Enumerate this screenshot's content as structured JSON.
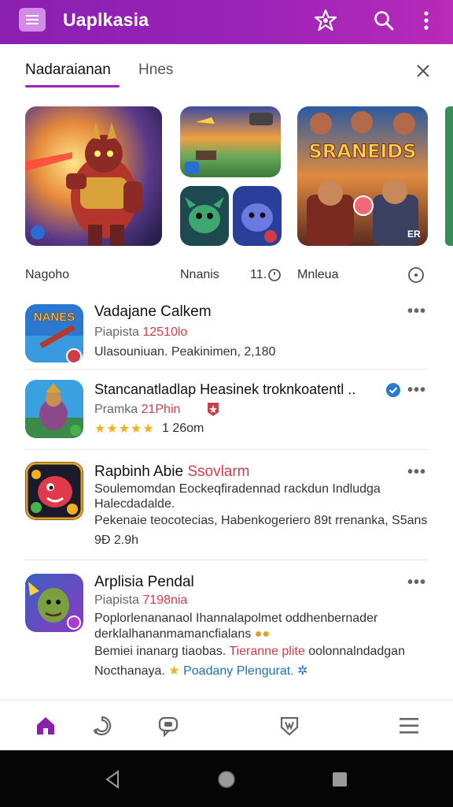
{
  "appbar": {
    "title": "Uaplkasia",
    "icons": [
      "menu-icon",
      "badge-star-icon",
      "search-icon",
      "more-vert-icon"
    ],
    "color": "#9a23b8"
  },
  "tabs": {
    "active": "Nadaraianan",
    "inactive": "Hnes"
  },
  "featured": {
    "label_left": "Nagoho",
    "label_mid": "Nnanis",
    "label_mid_count": "11.",
    "label_right": "Mnleua",
    "banner_text": "SRANEIDS",
    "banner_corner": "ER"
  },
  "list": [
    {
      "title": "Vadajane Calkem",
      "line1_a": "Piapista",
      "line1_b": "12510lo",
      "line2": "Ulasouniuan. Peakinimen, 2,180",
      "thumb_text": "NANES"
    },
    {
      "title": "Stancanatladlap Heasinek troknkoatentl ..",
      "line1_a": "Pramka",
      "line1_b": "21Phin",
      "rating": "1 26om",
      "stars": 5
    },
    {
      "title": "Rapbinh Abie",
      "title_b": "Ssovlarm",
      "line1": "Soulemomdan Eockeqfiradennad rackdun Indludga",
      "line2": "Halecdadalde.",
      "line3": "Pekenaie teocotecias, Habenkogeriero 89t rrenanka, S5ans",
      "line4": "9Đ 2.9h"
    },
    {
      "title": "Arplisia Pendal",
      "line1_a": "Piapista",
      "line1_b": "7198nia",
      "line2": "Poplorlenananaol Ihannalapolmet oddhenbernader",
      "line3": "derklalhananmamancfialans",
      "line4_a": "Bemiei inanarg tiaobas.",
      "line4_b": "Tieranne plite",
      "line4_c": "oolonnalndadgan",
      "line5_a": "Nocthanaya.",
      "line5_b": "Poadany Plengurat."
    }
  ],
  "bottom_nav": [
    "home-icon",
    "explore-icon",
    "chat-icon",
    "shield-icon",
    "hamburger-icon"
  ],
  "system_nav": [
    "back-icon",
    "home-circle-icon",
    "recents-icon"
  ]
}
